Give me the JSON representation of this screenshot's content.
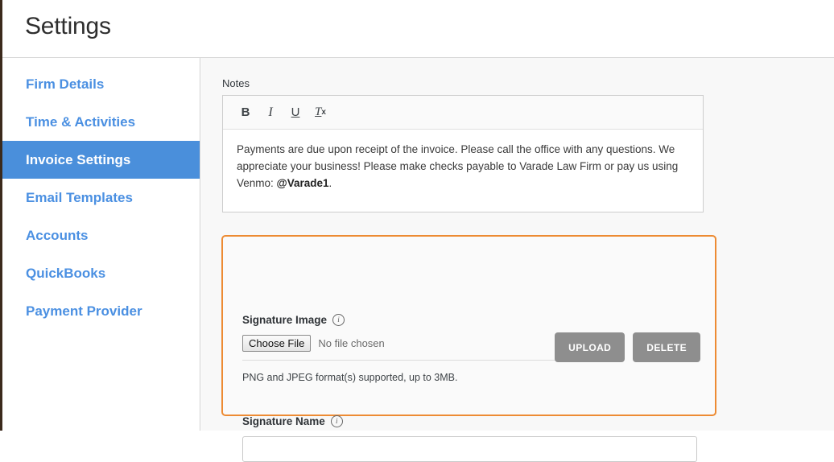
{
  "header": {
    "title": "Settings"
  },
  "sidebar": {
    "items": [
      {
        "label": "Firm Details",
        "active": false
      },
      {
        "label": "Time & Activities",
        "active": false
      },
      {
        "label": "Invoice Settings",
        "active": true
      },
      {
        "label": "Email Templates",
        "active": false
      },
      {
        "label": "Accounts",
        "active": false
      },
      {
        "label": "QuickBooks",
        "active": false
      },
      {
        "label": "Payment Provider",
        "active": false
      }
    ],
    "active_color": "#4a8fdb",
    "link_color": "#4b90e2"
  },
  "notes": {
    "label": "Notes",
    "toolbar": [
      {
        "name": "bold-icon",
        "glyph": "B"
      },
      {
        "name": "italic-icon",
        "glyph": "I"
      },
      {
        "name": "underline-icon",
        "glyph": "U"
      },
      {
        "name": "remove-format-icon",
        "glyph": "T",
        "sub": "x"
      }
    ],
    "body_text_1": "Payments are due upon receipt of the invoice. Please call the office with any questions. We appreciate your business! Please make checks payable to Varade Law Firm or pay us using Venmo: ",
    "body_mention": "@Varade1",
    "body_text_2": "."
  },
  "signature_panel": {
    "highlight_color": "#ed8b33",
    "image_label": "Signature Image",
    "info_icon_glyph": "i",
    "choose_file_label": "Choose File",
    "no_file_text": "No file chosen",
    "upload_label": "UPLOAD",
    "delete_label": "DELETE",
    "hint": "PNG and JPEG format(s) supported, up to 3MB.",
    "name_label": "Signature Name",
    "name_value": "",
    "name_placeholder": ""
  }
}
